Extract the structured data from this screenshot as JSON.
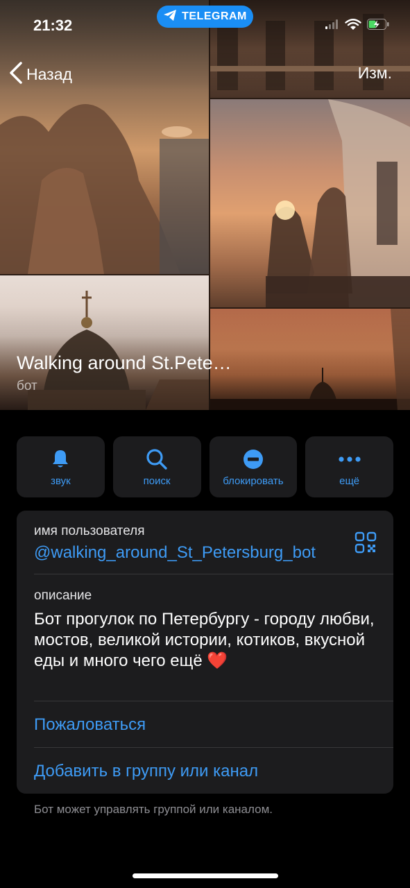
{
  "status_bar": {
    "time": "21:32",
    "app_pill_label": "TELEGRAM"
  },
  "nav": {
    "back_label": "Назад",
    "edit_label": "Изм."
  },
  "profile": {
    "name": "Walking around St.Pete…",
    "subtitle": "бот"
  },
  "actions": [
    {
      "label": "звук",
      "icon": "bell-icon"
    },
    {
      "label": "поиск",
      "icon": "search-icon"
    },
    {
      "label": "блокировать",
      "icon": "block-icon"
    },
    {
      "label": "ещё",
      "icon": "more-icon"
    }
  ],
  "info": {
    "username_label": "имя пользователя",
    "username": "@walking_around_St_Petersburg_bot",
    "description_label": "описание",
    "description": "Бот прогулок по Петербургу - городу любви, мостов, великой истории, котиков, вкусной еды и много чего ещё",
    "description_emoji": "❤️",
    "report_label": "Пожаловаться",
    "add_to_group_label": "Добавить в группу или канал"
  },
  "footnote": "Бот может управлять группой или каналом.",
  "colors": {
    "accent": "#3e9bf5",
    "card_bg": "#1c1c1e",
    "telegram_pill": "#1a8ef5"
  }
}
